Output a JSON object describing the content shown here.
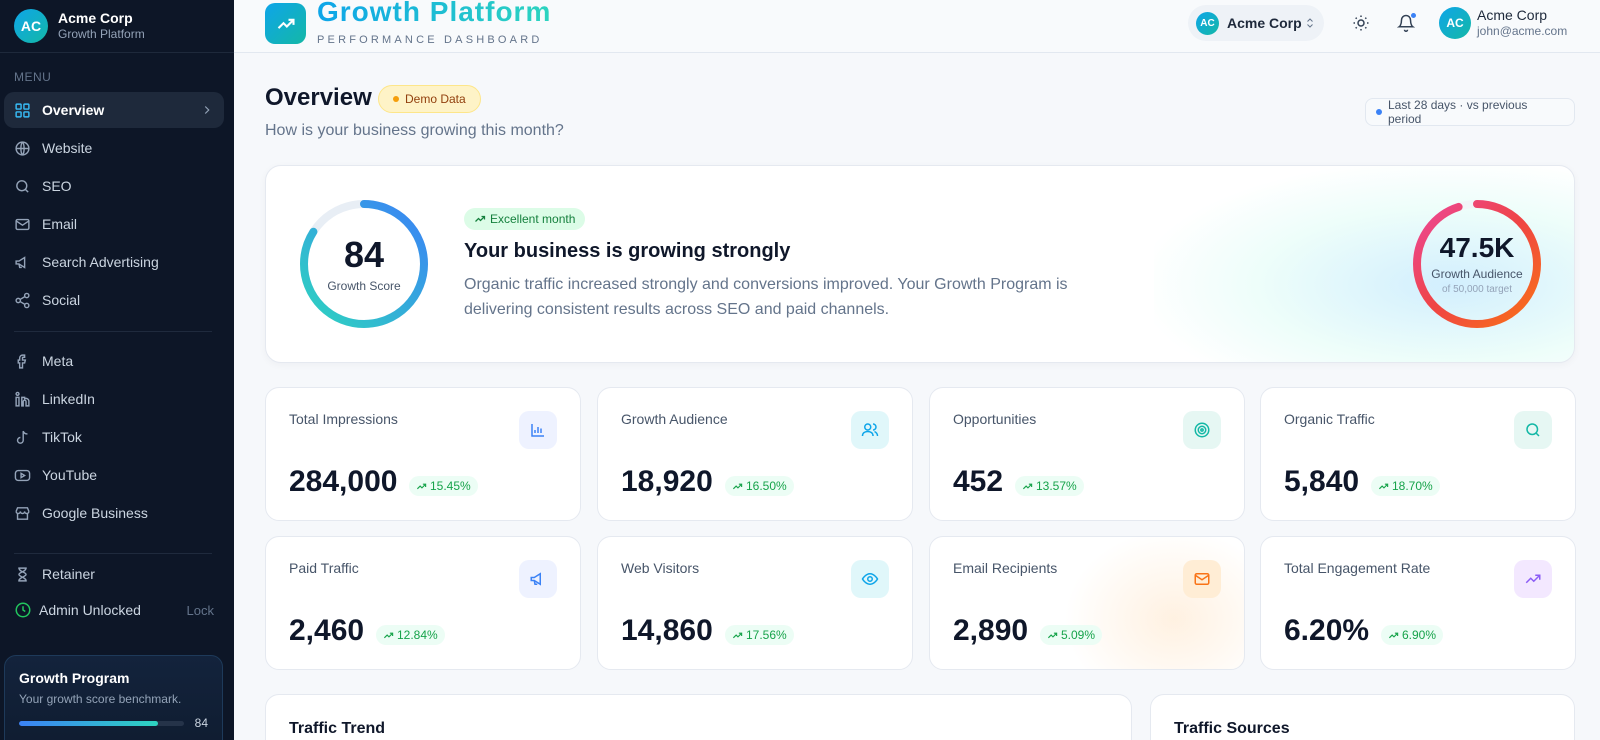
{
  "sidebar": {
    "org_initials": "AC",
    "org_name": "Acme Corp",
    "org_sub": "Growth Platform",
    "menu_label": "MENU",
    "items": [
      {
        "label": "Overview",
        "icon": "grid-icon"
      },
      {
        "label": "Website",
        "icon": "globe-icon"
      },
      {
        "label": "SEO",
        "icon": "search-icon"
      },
      {
        "label": "Email",
        "icon": "mail-icon"
      },
      {
        "label": "Search Advertising",
        "icon": "megaphone-icon"
      },
      {
        "label": "Social",
        "icon": "share-icon"
      },
      {
        "label": "Meta",
        "icon": "facebook-icon"
      },
      {
        "label": "LinkedIn",
        "icon": "linkedin-icon"
      },
      {
        "label": "TikTok",
        "icon": "tiktok-icon"
      },
      {
        "label": "YouTube",
        "icon": "youtube-icon"
      },
      {
        "label": "Google Business",
        "icon": "store-icon"
      },
      {
        "label": "Retainer",
        "icon": "hourglass-icon"
      }
    ],
    "admin_label": "Admin Unlocked",
    "lock_label": "Lock",
    "program": {
      "title": "Growth Program",
      "subtitle": "Your growth score benchmark.",
      "value": "84",
      "fraction": 0.84
    }
  },
  "header": {
    "app_title": "Growth Platform",
    "app_subtitle": "PERFORMANCE DASHBOARD",
    "org_initials": "AC",
    "org_name": "Acme Corp",
    "user_initials": "AC",
    "user_name": "Acme Corp",
    "user_email": "john@acme.com"
  },
  "page": {
    "title": "Overview",
    "badge": "Demo Data",
    "subtitle": "How is your business growing this month?",
    "period": "Last 28 days · vs previous period"
  },
  "hero": {
    "score": "84",
    "score_label": "Growth Score",
    "score_fraction": 0.84,
    "status": "Excellent month",
    "headline": "Your business is growing strongly",
    "body": "Organic traffic increased strongly and conversions improved. Your Growth Program is delivering consistent results across SEO and paid channels.",
    "audience_value": "47.5K",
    "audience_label": "Growth Audience",
    "audience_target": "of 50,000 target",
    "audience_fraction": 0.95
  },
  "metrics": [
    {
      "label": "Total Impressions",
      "value": "284,000",
      "delta": "15.45%",
      "icon": "bar-chart-icon",
      "icon_color": "#3b82f6",
      "icon_bg": "#eef2ff"
    },
    {
      "label": "Growth Audience",
      "value": "18,920",
      "delta": "16.50%",
      "icon": "users-icon",
      "icon_color": "#0ea5e9",
      "icon_bg": "#e0f7fa"
    },
    {
      "label": "Opportunities",
      "value": "452",
      "delta": "13.57%",
      "icon": "target-icon",
      "icon_color": "#14b8a6",
      "icon_bg": "#e6f7f3"
    },
    {
      "label": "Organic Traffic",
      "value": "5,840",
      "delta": "18.70%",
      "icon": "search-icon",
      "icon_color": "#14b8a6",
      "icon_bg": "#e6f7f3"
    },
    {
      "label": "Paid Traffic",
      "value": "2,460",
      "delta": "12.84%",
      "icon": "megaphone-icon",
      "icon_color": "#3b82f6",
      "icon_bg": "#eef2ff"
    },
    {
      "label": "Web Visitors",
      "value": "14,860",
      "delta": "17.56%",
      "icon": "eye-icon",
      "icon_color": "#0ea5e9",
      "icon_bg": "#e0f7fa"
    },
    {
      "label": "Email Recipients",
      "value": "2,890",
      "delta": "5.09%",
      "icon": "mail-icon",
      "icon_color": "#f97316",
      "icon_bg": "#ffedd5"
    },
    {
      "label": "Total Engagement Rate",
      "value": "6.20%",
      "delta": "6.90%",
      "icon": "trending-up-icon",
      "icon_color": "#8b5cf6",
      "icon_bg": "#f3e8ff"
    }
  ],
  "panels": {
    "traffic_trend": "Traffic Trend",
    "traffic_sources": "Traffic Sources"
  }
}
